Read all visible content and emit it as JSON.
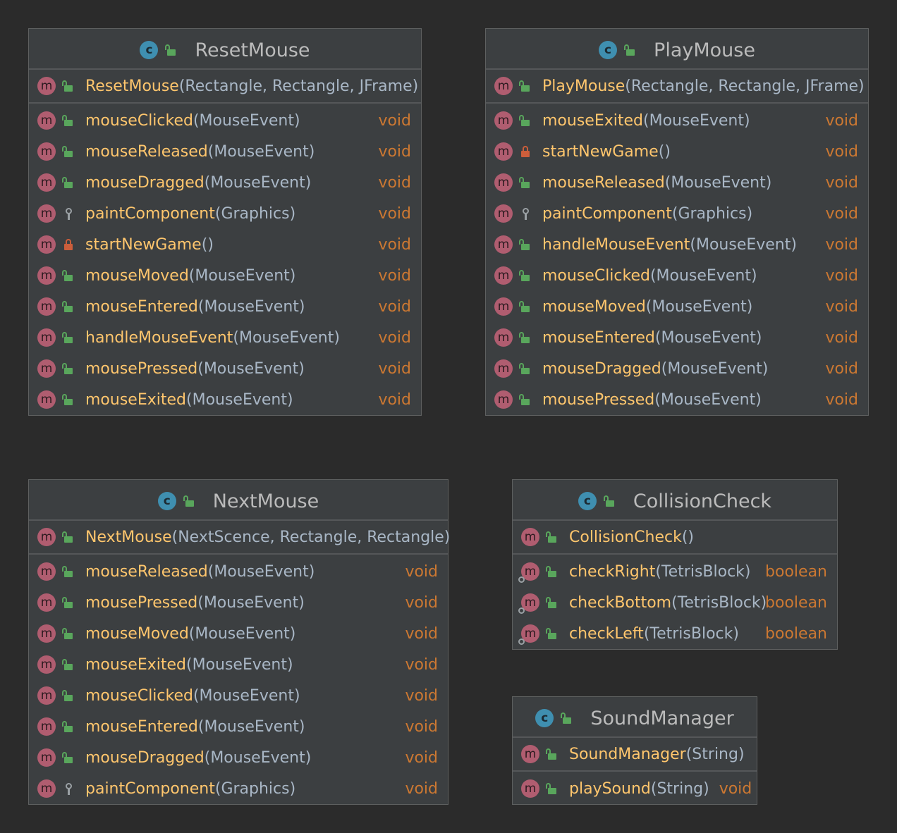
{
  "classes": {
    "reset_mouse": {
      "name": "ResetMouse",
      "constructor": {
        "name": "ResetMouse",
        "params": "(Rectangle, Rectangle, JFrame)"
      },
      "methods": [
        {
          "name": "mouseClicked",
          "params": "(MouseEvent)",
          "ret": "void",
          "vis": "public"
        },
        {
          "name": "mouseReleased",
          "params": "(MouseEvent)",
          "ret": "void",
          "vis": "public"
        },
        {
          "name": "mouseDragged",
          "params": "(MouseEvent)",
          "ret": "void",
          "vis": "public"
        },
        {
          "name": "paintComponent",
          "params": "(Graphics)",
          "ret": "void",
          "vis": "protected"
        },
        {
          "name": "startNewGame",
          "params": "()",
          "ret": "void",
          "vis": "private"
        },
        {
          "name": "mouseMoved",
          "params": "(MouseEvent)",
          "ret": "void",
          "vis": "public"
        },
        {
          "name": "mouseEntered",
          "params": "(MouseEvent)",
          "ret": "void",
          "vis": "public"
        },
        {
          "name": "handleMouseEvent",
          "params": "(MouseEvent)",
          "ret": "void",
          "vis": "public"
        },
        {
          "name": "mousePressed",
          "params": "(MouseEvent)",
          "ret": "void",
          "vis": "public"
        },
        {
          "name": "mouseExited",
          "params": "(MouseEvent)",
          "ret": "void",
          "vis": "public"
        }
      ]
    },
    "play_mouse": {
      "name": "PlayMouse",
      "constructor": {
        "name": "PlayMouse",
        "params": "(Rectangle, Rectangle, JFrame)"
      },
      "methods": [
        {
          "name": "mouseExited",
          "params": "(MouseEvent)",
          "ret": "void",
          "vis": "public"
        },
        {
          "name": "startNewGame",
          "params": "()",
          "ret": "void",
          "vis": "private"
        },
        {
          "name": "mouseReleased",
          "params": "(MouseEvent)",
          "ret": "void",
          "vis": "public"
        },
        {
          "name": "paintComponent",
          "params": "(Graphics)",
          "ret": "void",
          "vis": "protected"
        },
        {
          "name": "handleMouseEvent",
          "params": "(MouseEvent)",
          "ret": "void",
          "vis": "public"
        },
        {
          "name": "mouseClicked",
          "params": "(MouseEvent)",
          "ret": "void",
          "vis": "public"
        },
        {
          "name": "mouseMoved",
          "params": "(MouseEvent)",
          "ret": "void",
          "vis": "public"
        },
        {
          "name": "mouseEntered",
          "params": "(MouseEvent)",
          "ret": "void",
          "vis": "public"
        },
        {
          "name": "mouseDragged",
          "params": "(MouseEvent)",
          "ret": "void",
          "vis": "public"
        },
        {
          "name": "mousePressed",
          "params": "(MouseEvent)",
          "ret": "void",
          "vis": "public"
        }
      ]
    },
    "next_mouse": {
      "name": "NextMouse",
      "constructor": {
        "name": "NextMouse",
        "params": "(NextScence, Rectangle, Rectangle)"
      },
      "methods": [
        {
          "name": "mouseReleased",
          "params": "(MouseEvent)",
          "ret": "void",
          "vis": "public"
        },
        {
          "name": "mousePressed",
          "params": "(MouseEvent)",
          "ret": "void",
          "vis": "public"
        },
        {
          "name": "mouseMoved",
          "params": "(MouseEvent)",
          "ret": "void",
          "vis": "public"
        },
        {
          "name": "mouseExited",
          "params": "(MouseEvent)",
          "ret": "void",
          "vis": "public"
        },
        {
          "name": "mouseClicked",
          "params": "(MouseEvent)",
          "ret": "void",
          "vis": "public"
        },
        {
          "name": "mouseEntered",
          "params": "(MouseEvent)",
          "ret": "void",
          "vis": "public"
        },
        {
          "name": "mouseDragged",
          "params": "(MouseEvent)",
          "ret": "void",
          "vis": "public"
        },
        {
          "name": "paintComponent",
          "params": "(Graphics)",
          "ret": "void",
          "vis": "protected"
        }
      ]
    },
    "collision_check": {
      "name": "CollisionCheck",
      "constructor": {
        "name": "CollisionCheck",
        "params": "()"
      },
      "methods": [
        {
          "name": "checkRight",
          "params": "(TetrisBlock)",
          "ret": "boolean",
          "vis": "public",
          "static": true
        },
        {
          "name": "checkBottom",
          "params": "(TetrisBlock)",
          "ret": "boolean",
          "vis": "public",
          "static": true
        },
        {
          "name": "checkLeft",
          "params": "(TetrisBlock)",
          "ret": "boolean",
          "vis": "public",
          "static": true
        }
      ]
    },
    "sound_manager": {
      "name": "SoundManager",
      "constructor": {
        "name": "SoundManager",
        "params": "(String)"
      },
      "methods": [
        {
          "name": "playSound",
          "params": "(String)",
          "ret": "void",
          "vis": "public"
        }
      ]
    }
  },
  "icons": {
    "class_glyph": "c",
    "method_glyph": "m"
  },
  "colors": {
    "background": "#2b2b2b",
    "panel": "#3c3f41",
    "method_name": "#ffc66d",
    "params": "#a9b7c6",
    "return_type": "#cc7832",
    "class_icon": "#3f8fb0",
    "method_icon": "#b05d70",
    "public": "#59a65c",
    "private": "#cc5e3b"
  }
}
